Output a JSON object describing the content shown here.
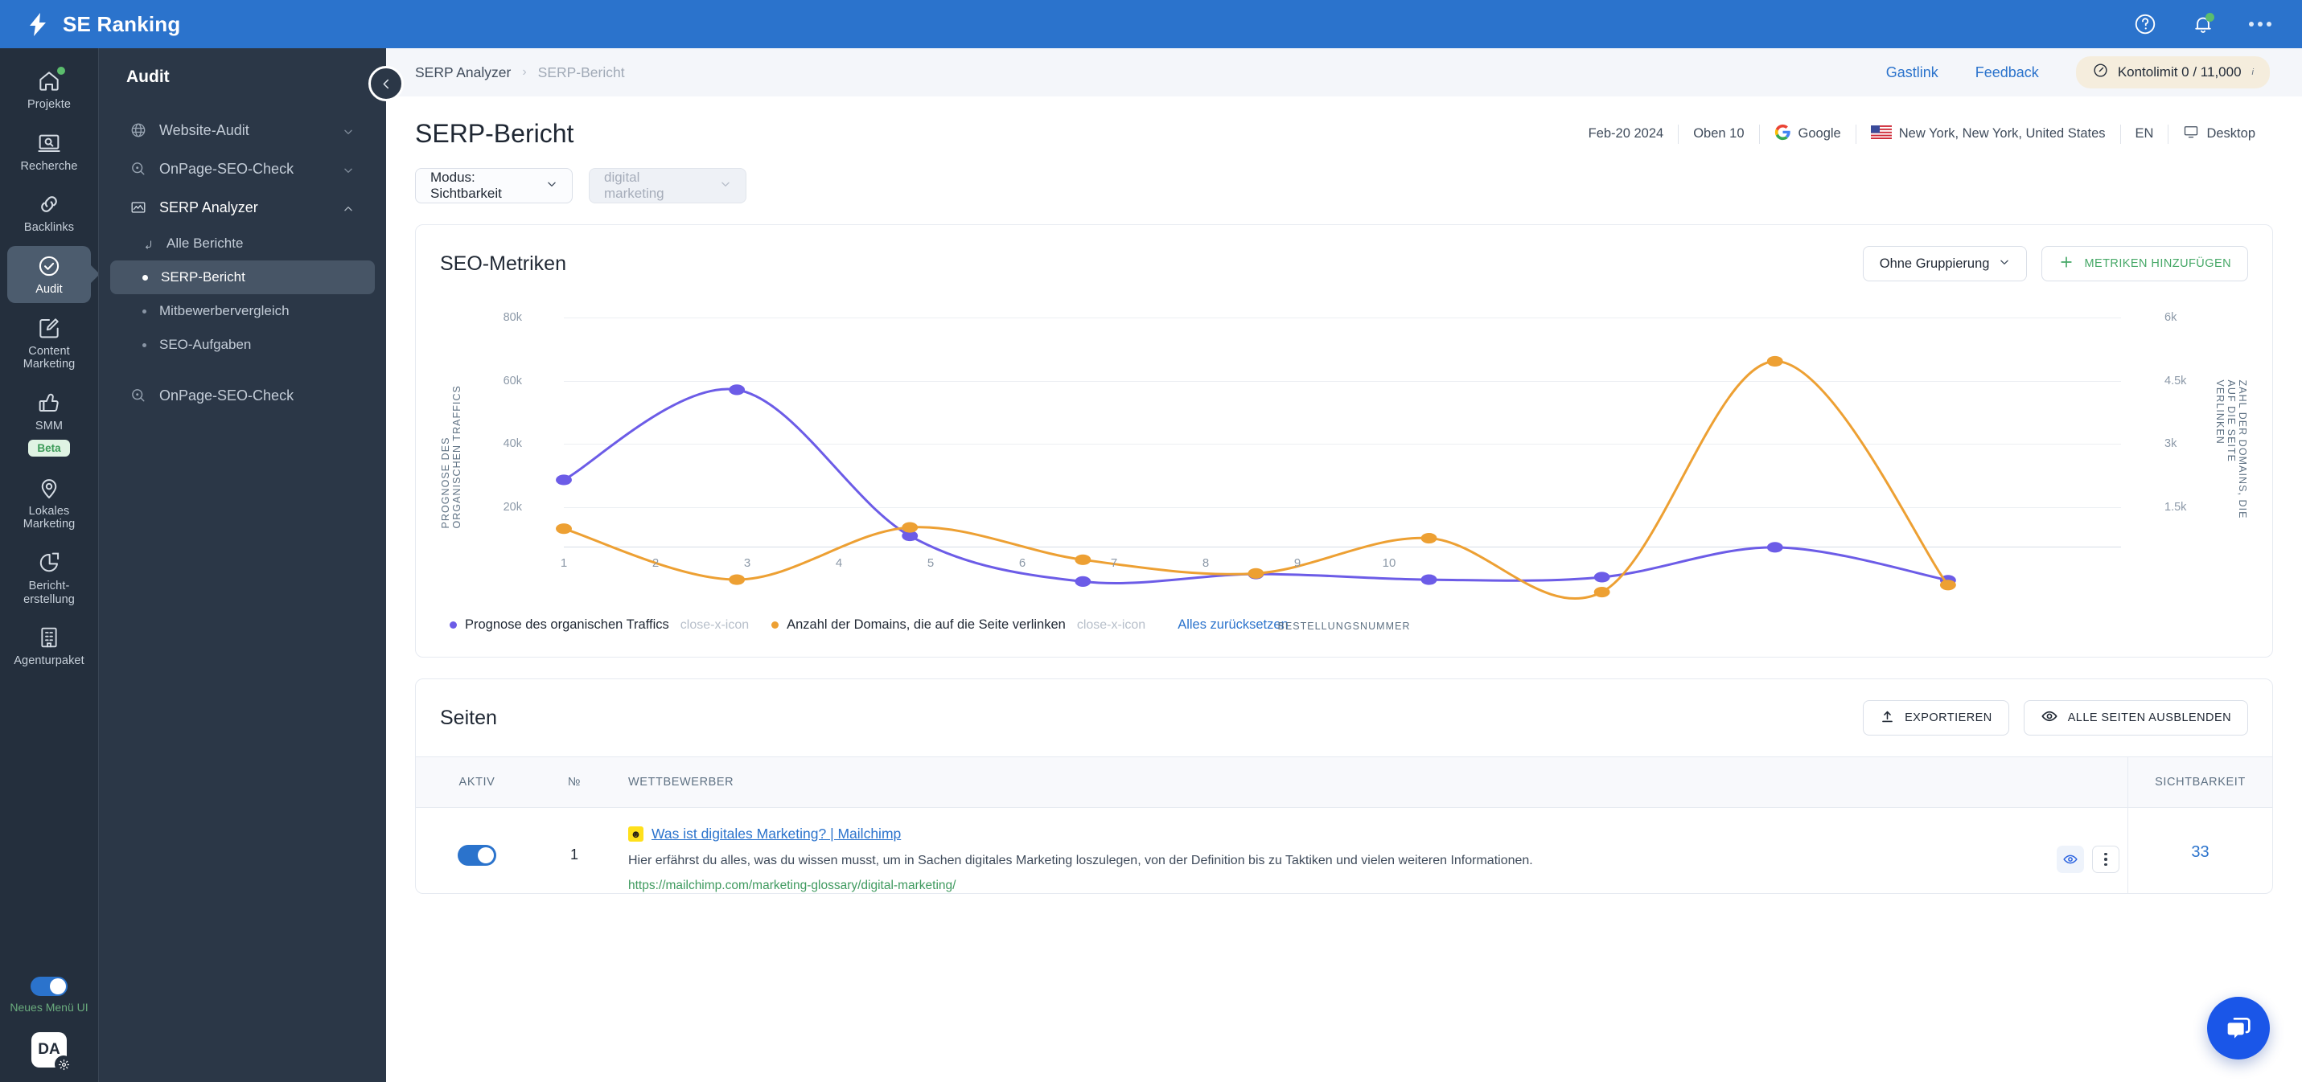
{
  "topbar": {
    "brand": "SE Ranking",
    "logo_icon": "lightning-bolt-logo",
    "help_icon": "help-circle-icon",
    "notifications_icon": "bell-icon",
    "more_icon": "more-horizontal-icon"
  },
  "rail": {
    "items": [
      {
        "label": "Projekte",
        "icon": "home-icon",
        "badge_dot": true,
        "active": false
      },
      {
        "label": "Recherche",
        "icon": "research-magnifier-icon",
        "active": false
      },
      {
        "label": "Backlinks",
        "icon": "link-chain-icon",
        "active": false
      },
      {
        "label": "Audit",
        "icon": "check-circle-icon",
        "active": true
      },
      {
        "label": "Content Marketing",
        "icon": "edit-square-icon",
        "active": false
      },
      {
        "label": "SMM",
        "icon": "thumbs-up-icon",
        "pill": "Beta",
        "active": false
      },
      {
        "label": "Lokales Marketing",
        "icon": "map-pin-icon",
        "active": false
      },
      {
        "label": "Bericht- erstellung",
        "icon": "pie-chart-icon",
        "active": false
      },
      {
        "label": "Agenturpaket",
        "icon": "building-icon",
        "active": false
      }
    ],
    "toggle_label": "Neues Menü UI",
    "toggle_on": true,
    "avatar_initials": "DA",
    "avatar_gear_icon": "gear-icon"
  },
  "submenu": {
    "title": "Audit",
    "groups": [
      {
        "label": "Website-Audit",
        "icon": "globe-icon",
        "chevron": "chevron-down-icon",
        "expanded": false
      },
      {
        "label": "OnPage-SEO-Check",
        "icon": "magnifier-dot-icon",
        "chevron": "chevron-down-icon",
        "expanded": false
      },
      {
        "label": "SERP Analyzer",
        "icon": "chart-mountain-icon",
        "chevron": "chevron-up-icon",
        "expanded": true
      }
    ],
    "serp_children": [
      {
        "label": "Alle Berichte",
        "marker": "turn-up-left-icon",
        "active": false
      },
      {
        "label": "SERP-Bericht",
        "marker": "bullet",
        "active": true
      },
      {
        "label": "Mitbewerbervergleich",
        "marker": "bullet-dim",
        "active": false
      },
      {
        "label": "SEO-Aufgaben",
        "marker": "bullet-dim",
        "active": false
      }
    ],
    "trailing_group": {
      "label": "OnPage-SEO-Check",
      "icon": "magnifier-dot-icon"
    }
  },
  "breadcrumb": {
    "collapse_icon": "chevron-left-icon",
    "items": [
      "SERP Analyzer",
      "SERP-Bericht"
    ],
    "separator": "›",
    "guest_link": "Gastlink",
    "feedback_link": "Feedback",
    "limit_icon": "gauge-icon",
    "limit_label": "Kontolimit 0 / 11,000",
    "limit_sup": "i"
  },
  "page": {
    "title": "SERP-Bericht",
    "meta": {
      "date": "Feb-20 2024",
      "top": "Oben 10",
      "engine": "Google",
      "engine_icon": "google-g-icon",
      "location": "New York, New York, United States",
      "location_flag": "us-flag-icon",
      "language": "EN",
      "device": "Desktop",
      "device_icon": "monitor-icon"
    },
    "filters": {
      "mode_label": "Modus: Sichtbarkeit",
      "keyword_placeholder": "digital marketing",
      "chevron_icon": "chevron-down-icon"
    }
  },
  "metrics_card": {
    "title": "SEO-Metriken",
    "grouping_label": "Ohne Gruppierung",
    "add_metrics_label": "METRIKEN HINZUFÜGEN",
    "add_icon": "plus-icon",
    "chevron_icon": "chevron-down-icon",
    "legend_reset": "Alles zurücksetzen",
    "legend_remove_icon": "close-x-icon"
  },
  "chart_data": {
    "type": "line",
    "title": "SEO-Metriken",
    "xlabel": "BESTELLUNGSNUMMER",
    "ylabel": "PROGNOSE DES ORGANISCHEN TRAFFICS",
    "y2label": "ZAHL DER DOMAINS, DIE AUF DIE SEITE VERLINKEN",
    "x": [
      1,
      2,
      3,
      4,
      5,
      6,
      7,
      8,
      9,
      10
    ],
    "xtick_labels": [
      "1",
      "2",
      "3",
      "4",
      "5",
      "6",
      "7",
      "8",
      "9",
      "10"
    ],
    "ytick_labels": [
      "20k",
      "40k",
      "60k",
      "80k"
    ],
    "ytick_values": [
      20000,
      40000,
      60000,
      80000
    ],
    "ylim": [
      0,
      88000
    ],
    "y2tick_labels": [
      "1.5k",
      "3k",
      "4.5k",
      "6k"
    ],
    "y2tick_values": [
      1500,
      3000,
      4500,
      6000
    ],
    "y2lim": [
      0,
      6600
    ],
    "grid": true,
    "legend_position": "bottom-left",
    "series": [
      {
        "name": "Prognose des organischen Traffics",
        "color": "#6c5ce7",
        "axis": "left",
        "x": [
          1,
          2,
          3,
          4,
          5,
          6,
          7,
          8,
          9
        ],
        "values": [
          36500,
          65500,
          18500,
          3800,
          6200,
          4400,
          5200,
          14800,
          4200
        ]
      },
      {
        "name": "Anzahl der Domains, die auf die Seite verlinken",
        "color": "#eda033",
        "axis": "right",
        "x": [
          1,
          2,
          3,
          4,
          5,
          6,
          7,
          8,
          9
        ],
        "values": [
          1560,
          330,
          1590,
          810,
          480,
          1330,
          30,
          5600,
          200
        ]
      }
    ]
  },
  "pages_card": {
    "title": "Seiten",
    "export_label": "EXPORTIEREN",
    "export_icon": "upload-icon",
    "hide_all_label": "ALLE SEITEN AUSBLENDEN",
    "hide_all_icon": "eye-icon",
    "columns": [
      "AKTIV",
      "№",
      "WETTBEWERBER",
      "SICHTBARKEIT"
    ],
    "rows": [
      {
        "active": true,
        "number": "1",
        "favicon": "mailchimp-favicon",
        "title": "Was ist digitales Marketing? | Mailchimp",
        "description": "Hier erfährst du alles, was du wissen musst, um in Sachen digitales Marketing loszulegen, von der Definition bis zu Taktiken und vielen weiteren Informationen.",
        "url": "https://mailchimp.com/marketing-glossary/digital-marketing/",
        "visibility": "33",
        "eye_icon": "eye-icon",
        "menu_icon": "kebab-menu-icon"
      }
    ]
  },
  "chat": {
    "icon": "chat-bubble-icon",
    "color": "#1a56e8"
  }
}
